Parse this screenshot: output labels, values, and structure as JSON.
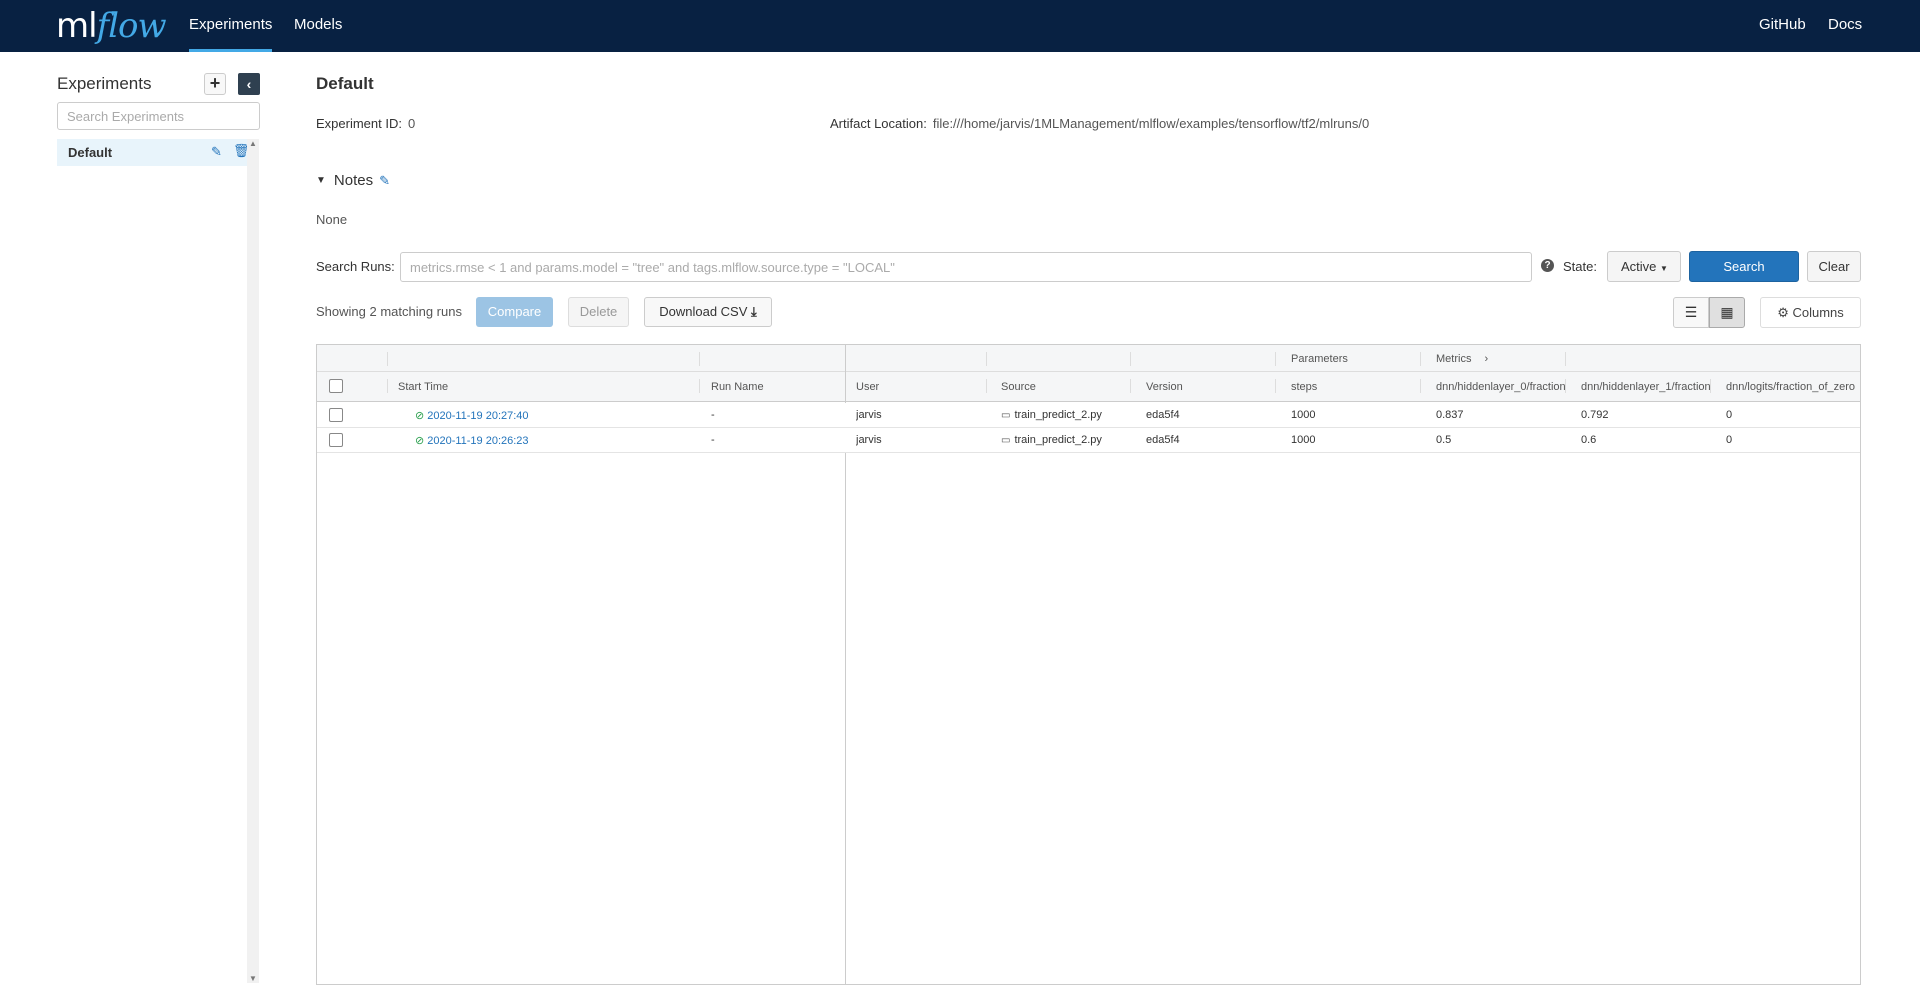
{
  "header": {
    "logo_ml": "ml",
    "logo_flow": "flow",
    "nav": {
      "experiments": "Experiments",
      "models": "Models",
      "github": "GitHub",
      "docs": "Docs"
    }
  },
  "sidebar": {
    "title": "Experiments",
    "add_icon": "+",
    "collapse_icon": "‹",
    "search_placeholder": "Search Experiments",
    "items": [
      {
        "label": "Default"
      }
    ]
  },
  "experiment": {
    "title": "Default",
    "id_label": "Experiment ID:",
    "id_value": "0",
    "artifact_label": "Artifact Location:",
    "artifact_value": "file:///home/jarvis/1MLManagement/mlflow/examples/tensorflow/tf2/mlruns/0",
    "notes_label": "Notes",
    "notes_value": "None"
  },
  "search": {
    "label": "Search Runs:",
    "placeholder": "metrics.rmse < 1 and params.model = \"tree\" and tags.mlflow.source.type = \"LOCAL\"",
    "state_label": "State:",
    "state_value": "Active",
    "search_button": "Search",
    "clear_button": "Clear"
  },
  "toolbar": {
    "showing": "Showing 2 matching runs",
    "compare": "Compare",
    "delete": "Delete",
    "download": "Download CSV",
    "columns": "Columns"
  },
  "table": {
    "groups": {
      "parameters": "Parameters",
      "metrics": "Metrics"
    },
    "headers": {
      "start_time": "Start Time",
      "run_name": "Run Name",
      "user": "User",
      "source": "Source",
      "version": "Version",
      "steps": "steps",
      "m0": "dnn/hiddenlayer_0/fraction",
      "m1": "dnn/hiddenlayer_1/fraction",
      "m2": "dnn/logits/fraction_of_zero"
    },
    "rows": [
      {
        "start_time": "2020-11-19 20:27:40",
        "run_name": "-",
        "user": "jarvis",
        "source": "train_predict_2.py",
        "version": "eda5f4",
        "steps": "1000",
        "m0": "0.837",
        "m1": "0.792",
        "m2": "0"
      },
      {
        "start_time": "2020-11-19 20:26:23",
        "run_name": "-",
        "user": "jarvis",
        "source": "train_predict_2.py",
        "version": "eda5f4",
        "steps": "1000",
        "m0": "0.5",
        "m1": "0.6",
        "m2": "0"
      }
    ]
  },
  "colors": {
    "header_bg": "#082142",
    "accent": "#43a9e6",
    "primary": "#2374bb",
    "success": "#2ca04f"
  }
}
